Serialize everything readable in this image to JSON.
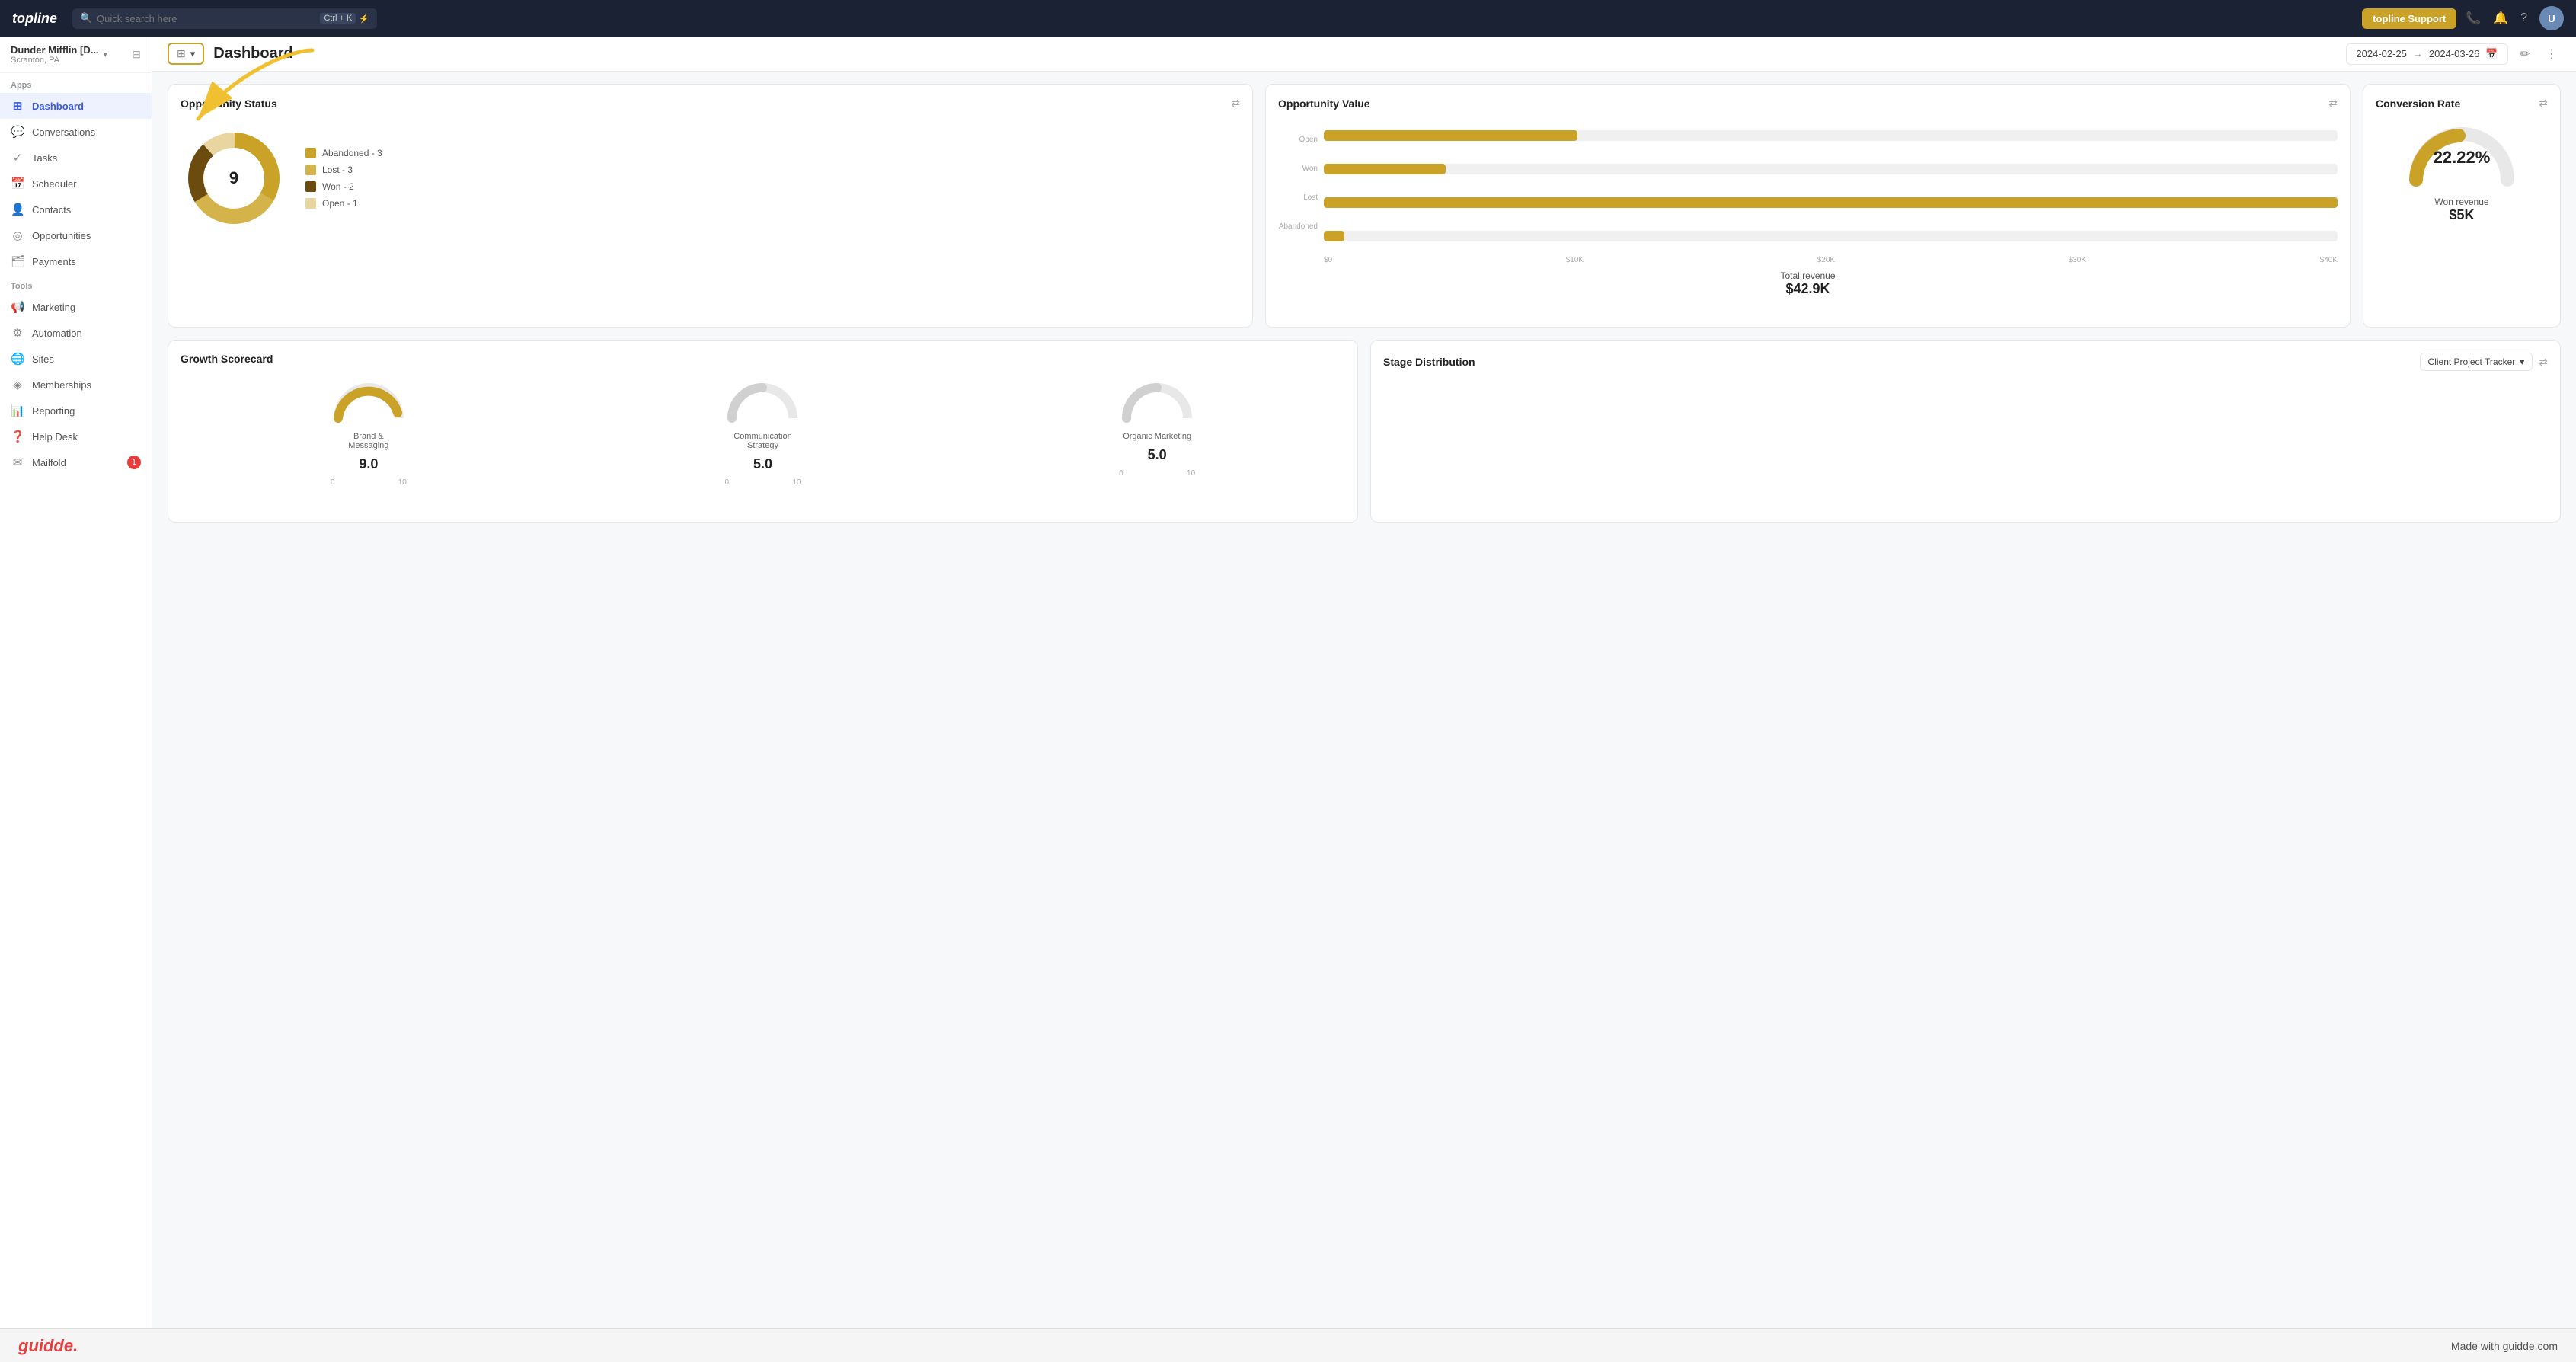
{
  "topnav": {
    "logo": "topline",
    "search_placeholder": "Quick search here",
    "search_shortcut": "Ctrl + K",
    "lightning_icon": "⚡",
    "support_btn": "topline Support",
    "phone_icon": "📞",
    "bell_icon": "🔔",
    "help_icon": "?",
    "avatar_initials": "U"
  },
  "sidebar": {
    "workspace_name": "Dunder Mifflin [D...",
    "workspace_sub": "Scranton, PA",
    "sections": [
      {
        "label": "Apps",
        "items": [
          {
            "id": "dashboard",
            "label": "Dashboard",
            "icon": "⊞",
            "active": true
          },
          {
            "id": "conversations",
            "label": "Conversations",
            "icon": "💬"
          },
          {
            "id": "tasks",
            "label": "Tasks",
            "icon": "✓"
          },
          {
            "id": "scheduler",
            "label": "Scheduler",
            "icon": "📅"
          },
          {
            "id": "contacts",
            "label": "Contacts",
            "icon": "👤"
          },
          {
            "id": "opportunities",
            "label": "Opportunities",
            "icon": "◎"
          },
          {
            "id": "payments",
            "label": "Payments",
            "icon": "🗂"
          }
        ]
      },
      {
        "label": "Tools",
        "items": [
          {
            "id": "marketing",
            "label": "Marketing",
            "icon": "📢"
          },
          {
            "id": "automation",
            "label": "Automation",
            "icon": "⚙"
          },
          {
            "id": "sites",
            "label": "Sites",
            "icon": "🌐"
          },
          {
            "id": "memberships",
            "label": "Memberships",
            "icon": "◈"
          },
          {
            "id": "reporting",
            "label": "Reporting",
            "icon": "❓"
          },
          {
            "id": "helpdesk",
            "label": "Help Desk",
            "icon": "❓"
          },
          {
            "id": "mailfold",
            "label": "Mailfold",
            "icon": "✉",
            "badge": "1"
          }
        ]
      }
    ]
  },
  "subheader": {
    "view_btn_icon": "⊞",
    "page_title": "Dashboard",
    "date_from": "2024-02-25",
    "date_to": "2024-03-26",
    "edit_icon": "✏",
    "more_icon": "⋮"
  },
  "cards": {
    "opportunity_status": {
      "title": "Opportunity Status",
      "center_value": "9",
      "legend": [
        {
          "label": "Abandoned - 3",
          "color": "#c9a227"
        },
        {
          "label": "Lost - 3",
          "color": "#d4b44a"
        },
        {
          "label": "Won - 2",
          "color": "#6b4c0e"
        },
        {
          "label": "Open - 1",
          "color": "#e8d5a0"
        }
      ],
      "donut": {
        "segments": [
          {
            "pct": 33,
            "color": "#c9a227"
          },
          {
            "pct": 33,
            "color": "#d4b44a"
          },
          {
            "pct": 22,
            "color": "#6b4c0e"
          },
          {
            "pct": 12,
            "color": "#e8d5a0"
          }
        ]
      }
    },
    "opportunity_value": {
      "title": "Opportunity Value",
      "bars": [
        {
          "label": "Open",
          "value": 10,
          "max": 40,
          "display": "$10K"
        },
        {
          "label": "Won",
          "value": 5,
          "max": 40,
          "display": "$5K"
        },
        {
          "label": "Lost",
          "value": 40,
          "max": 40,
          "display": "$40K"
        },
        {
          "label": "Abandoned",
          "value": 0,
          "max": 40,
          "display": "$0"
        }
      ],
      "x_labels": [
        "$0",
        "$10K",
        "$20K",
        "$30K",
        "$40K"
      ],
      "total_label": "Total revenue",
      "total_value": "$42.9K"
    },
    "conversion_rate": {
      "title": "Conversion Rate",
      "percentage": "22.22%",
      "won_revenue_label": "Won revenue",
      "won_revenue_value": "$5K",
      "gauge_pct": 22.22
    },
    "growth_scorecard": {
      "title": "Growth Scorecard",
      "items": [
        {
          "label": "Brand & Messaging",
          "value": "9.0",
          "pct": 90,
          "color": "#c9a227"
        },
        {
          "label": "Communication Strategy",
          "value": "5.0",
          "pct": 50,
          "color": "#d0d0d0"
        },
        {
          "label": "Organic Marketing",
          "value": "5.0",
          "pct": 50,
          "color": "#d0d0d0"
        }
      ],
      "range_min": "0",
      "range_max": "10"
    },
    "stage_distribution": {
      "title": "Stage Distribution",
      "dropdown_label": "Client Project Tracker",
      "filter_icon": "⇄"
    }
  },
  "annotation": {
    "arrow_color": "#f0c030"
  },
  "bottombar": {
    "logo": "guidde.",
    "tagline": "Made with guidde.com"
  }
}
